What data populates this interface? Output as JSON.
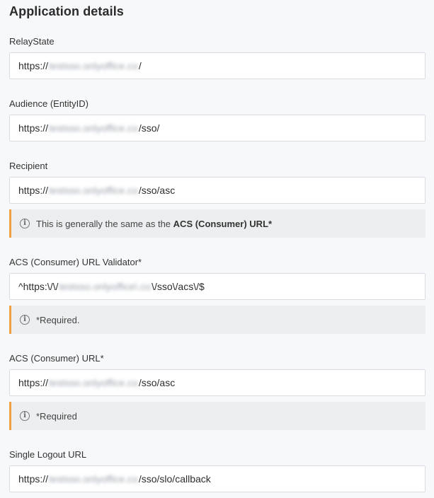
{
  "title": "Application details",
  "fields": [
    {
      "label": "RelayState",
      "prefix": "https://",
      "masked": "testsso.onlyoffice.co",
      "suffix": "/"
    },
    {
      "label": "Audience (EntityID)",
      "prefix": "https://",
      "masked": "testsso.onlyoffice.co",
      "suffix": "/sso/"
    },
    {
      "label": "Recipient",
      "prefix": "https://",
      "masked": "testsso.onlyoffice.co",
      "suffix": "/sso/asc",
      "hint_text": "This is generally the same as the ",
      "hint_bold": "ACS (Consumer) URL*"
    },
    {
      "label": "ACS (Consumer) URL Validator*",
      "prefix": "^https:\\/\\/",
      "masked": "testsso.onlyoffice\\.co",
      "suffix": "\\/sso\\/acs\\/$",
      "hint_text": "*Required."
    },
    {
      "label": "ACS (Consumer) URL*",
      "prefix": "https://",
      "masked": "testsso.onlyoffice.co",
      "suffix": "/sso/asc",
      "hint_text": "*Required"
    },
    {
      "label": "Single Logout URL",
      "prefix": "https://",
      "masked": "testsso.onlyoffice.co",
      "suffix": "/sso/slo/callback"
    }
  ],
  "icons": {
    "info": "info-circle-icon"
  },
  "colors": {
    "hint_accent": "#f0a040",
    "hint_background": "#eceeef",
    "page_background": "#f7f8fa"
  }
}
